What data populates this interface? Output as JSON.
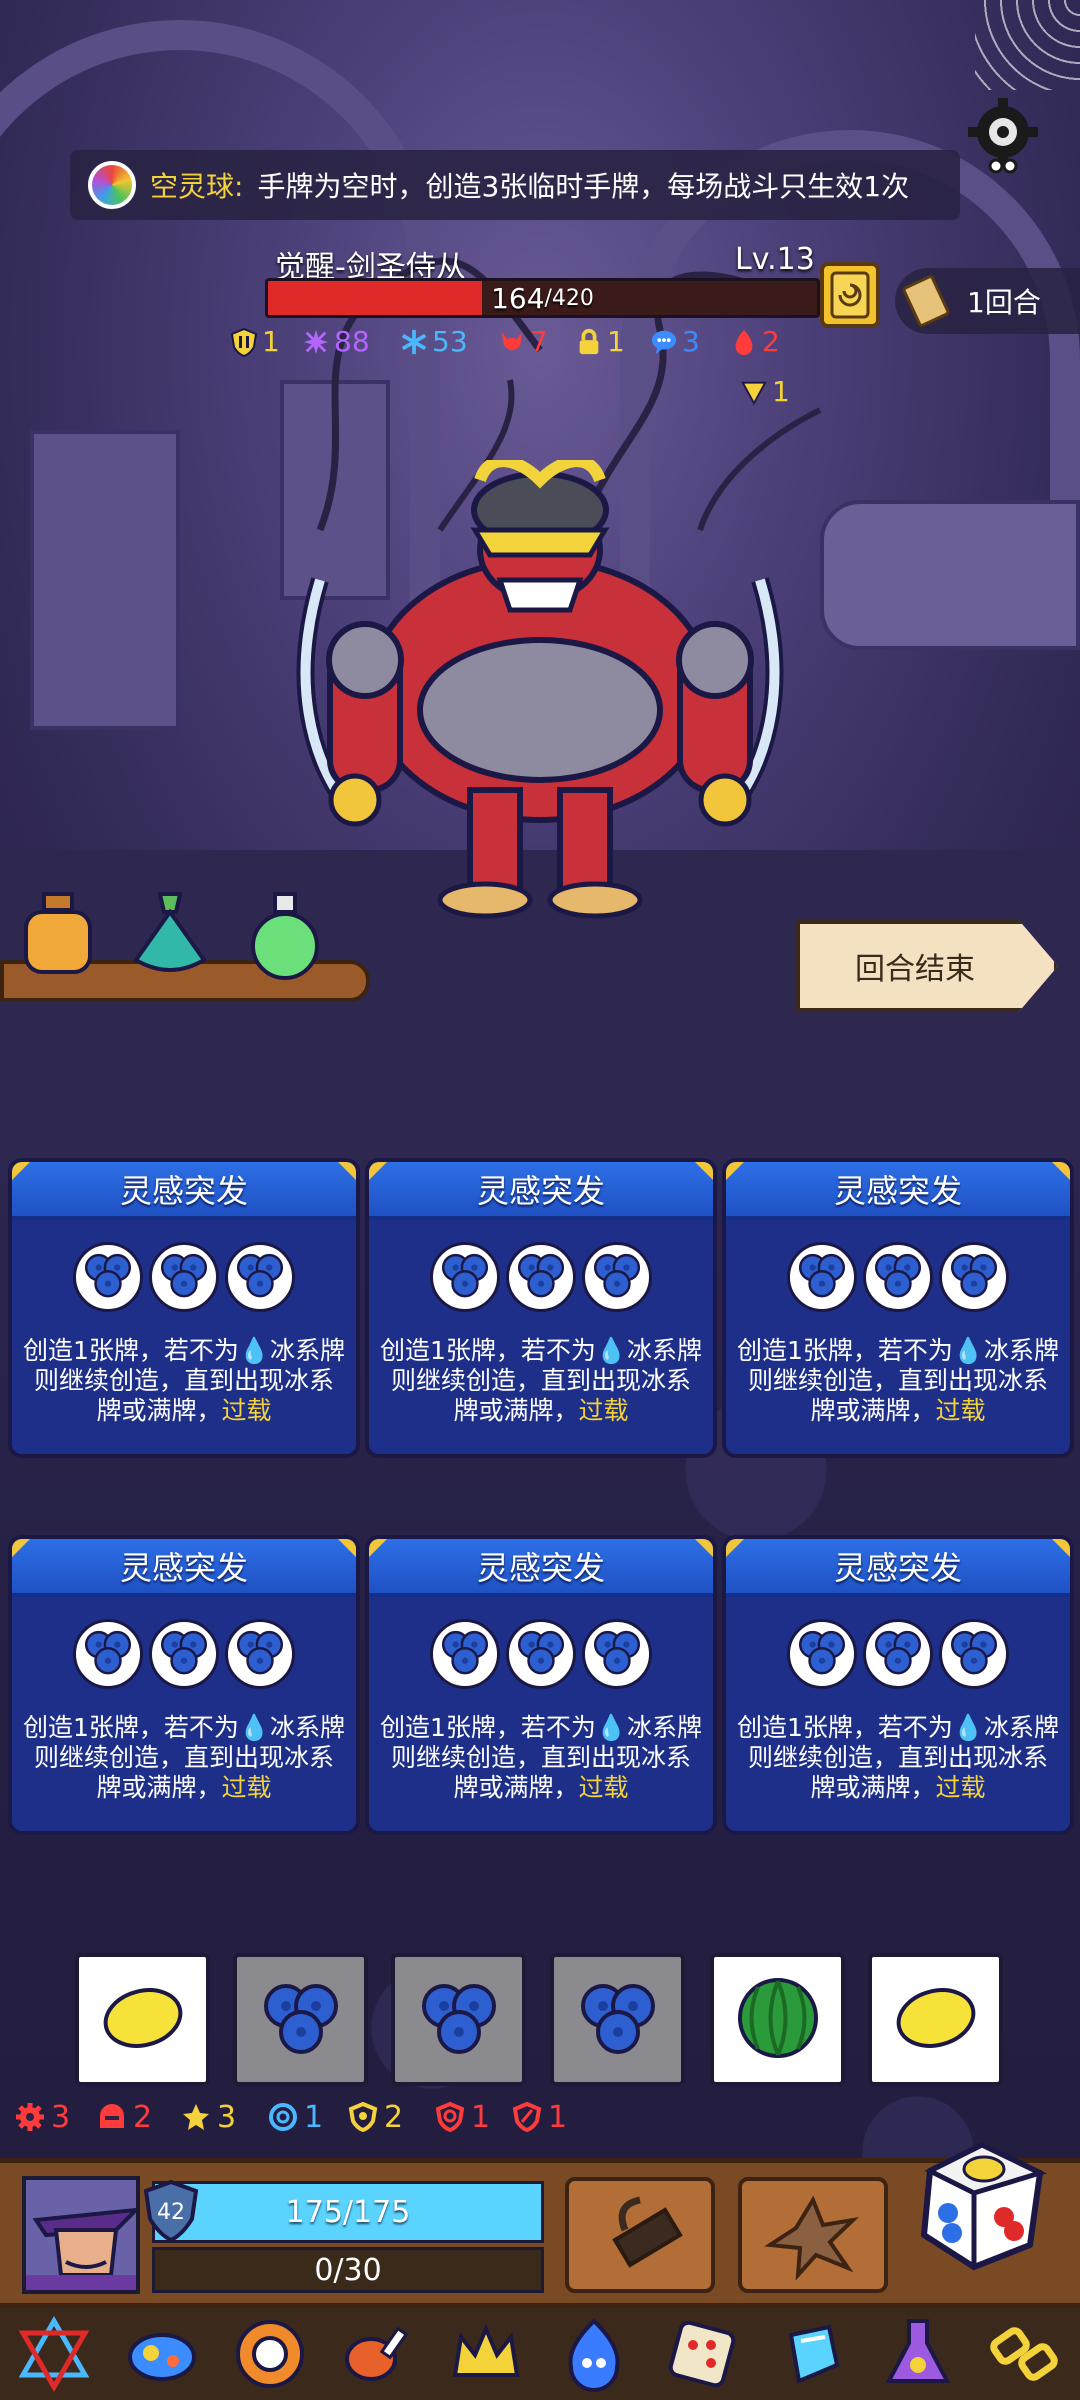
{
  "relic_banner": {
    "name": "空灵球:",
    "text": "手牌为空时，创造3张临时手牌，每场战斗只生效1次"
  },
  "enemy": {
    "name": "觉醒-剑圣侍从",
    "level": "Lv.13",
    "hp": 164,
    "hp_max_text": "/420",
    "hp_fraction": 0.39,
    "status": [
      {
        "icon": "armor-icon",
        "value": "1",
        "color": "#f4d23a"
      },
      {
        "icon": "purple-spark-icon",
        "value": "88",
        "color": "#b565ff"
      },
      {
        "icon": "snowflake-icon",
        "value": "53",
        "color": "#4ab8ff"
      },
      {
        "icon": "demon-icon",
        "value": "7",
        "color": "#ff3b3b"
      },
      {
        "icon": "lock-icon",
        "value": "1",
        "color": "#f4d23a"
      },
      {
        "icon": "speech-icon",
        "value": "3",
        "color": "#3a8cff"
      },
      {
        "icon": "flame-icon",
        "value": "2",
        "color": "#ff3b3b"
      },
      {
        "icon": "triangle-icon",
        "value": "1",
        "color": "#f4d23a"
      }
    ]
  },
  "round": "1回合",
  "end_turn_label": "回合结束",
  "cards": [
    {
      "title": "灵感突发",
      "desc_a": "创造1张牌，若不为",
      "desc_b": "冰系牌则继续创造，直到出现冰系牌或满牌，",
      "keyword": "过载"
    },
    {
      "title": "灵感突发",
      "desc_a": "创造1张牌，若不为",
      "desc_b": "冰系牌则继续创造，直到出现冰系牌或满牌，",
      "keyword": "过载"
    },
    {
      "title": "灵感突发",
      "desc_a": "创造1张牌，若不为",
      "desc_b": "冰系牌则继续创造，直到出现冰系牌或满牌，",
      "keyword": "过载"
    },
    {
      "title": "灵感突发",
      "desc_a": "创造1张牌，若不为",
      "desc_b": "冰系牌则继续创造，直到出现冰系牌或满牌，",
      "keyword": "过载"
    },
    {
      "title": "灵感突发",
      "desc_a": "创造1张牌，若不为",
      "desc_b": "冰系牌则继续创造，直到出现冰系牌或满牌，",
      "keyword": "过载"
    },
    {
      "title": "灵感突发",
      "desc_a": "创造1张牌，若不为",
      "desc_b": "冰系牌则继续创造，直到出现冰系牌或满牌，",
      "keyword": "过载"
    }
  ],
  "dice": [
    {
      "face": "lemon-icon",
      "bg": "white"
    },
    {
      "face": "blueberry-icon",
      "bg": "grey"
    },
    {
      "face": "blueberry-icon",
      "bg": "grey"
    },
    {
      "face": "blueberry-icon",
      "bg": "grey"
    },
    {
      "face": "watermelon-icon",
      "bg": "white"
    },
    {
      "face": "lemon-icon",
      "bg": "white"
    }
  ],
  "player_status": [
    {
      "icon": "gear-red-icon",
      "value": "3",
      "color": "#ff3b3b"
    },
    {
      "icon": "helmet-icon",
      "value": "2",
      "color": "#ff3b3b"
    },
    {
      "icon": "star-icon",
      "value": "3",
      "color": "#f4d23a"
    },
    {
      "icon": "swirl-icon",
      "value": "1",
      "color": "#4ab8ff"
    },
    {
      "icon": "shield-yellow-icon",
      "value": "2",
      "color": "#f4d23a"
    },
    {
      "icon": "shield-spiral-icon",
      "value": "1",
      "color": "#ff3b3b"
    },
    {
      "icon": "shield-sword-icon",
      "value": "1",
      "color": "#ff3b3b"
    }
  ],
  "player": {
    "armor": "42",
    "hp_text": "175/175",
    "hp_fraction": 1.0,
    "xp_text": "0/30"
  },
  "relics": [
    "hexagram-icon",
    "blue-gem-icon",
    "orange-ring-icon",
    "meat-icon",
    "crown-icon",
    "blue-flame-icon",
    "dice-cube-icon",
    "ice-crystal-icon",
    "potion-flask-icon",
    "chain-icon"
  ]
}
